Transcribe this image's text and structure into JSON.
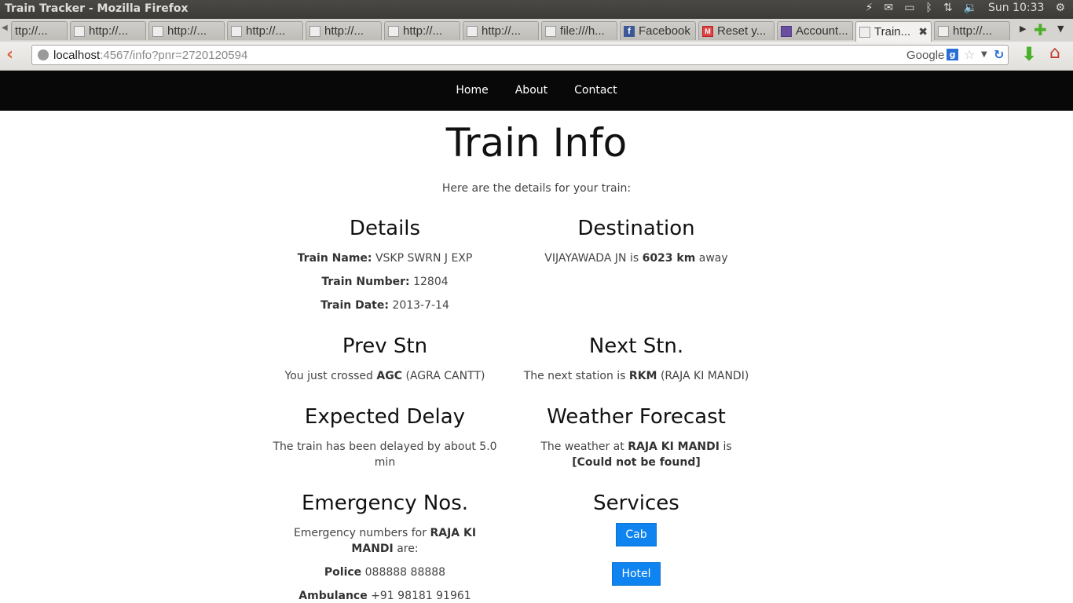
{
  "os": {
    "window_title": "Train Tracker - Mozilla Firefox",
    "clock": "Sun 10:33"
  },
  "tabs": [
    {
      "label": "ttp://..."
    },
    {
      "label": "http://..."
    },
    {
      "label": "http://..."
    },
    {
      "label": "http://..."
    },
    {
      "label": "http://..."
    },
    {
      "label": "http://..."
    },
    {
      "label": "http://..."
    },
    {
      "label": "file:///h..."
    },
    {
      "label": "Facebook"
    },
    {
      "label": "Reset y..."
    },
    {
      "label": "Account..."
    },
    {
      "label": "Train..."
    },
    {
      "label": "http://..."
    }
  ],
  "address_bar": {
    "host": "localhost",
    "path": ":4567/info?pnr=2720120594",
    "search_engine": "Google"
  },
  "site_nav": {
    "home": "Home",
    "about": "About",
    "contact": "Contact"
  },
  "page": {
    "title": "Train Info",
    "intro": "Here are the details for your train:"
  },
  "details": {
    "heading": "Details",
    "train_name_label": "Train Name:",
    "train_name": "VSKP SWRN J EXP",
    "train_number_label": "Train Number:",
    "train_number": "12804",
    "train_date_label": "Train Date:",
    "train_date": "2013-7-14"
  },
  "destination": {
    "heading": "Destination",
    "station": "VIJAYAWADA JN",
    "is": "is",
    "distance": "6023 km",
    "away": "away"
  },
  "prev_stn": {
    "heading": "Prev Stn",
    "prefix": "You just crossed",
    "code": "AGC",
    "name": "(AGRA CANTT)"
  },
  "next_stn": {
    "heading": "Next Stn.",
    "prefix": "The next station is",
    "code": "RKM",
    "name": "(RAJA KI MANDI)"
  },
  "delay": {
    "heading": "Expected Delay",
    "text": "The train has been delayed by about 5.0 min"
  },
  "weather": {
    "heading": "Weather Forecast",
    "prefix": "The weather at",
    "station": "RAJA KI MANDI",
    "is": "is",
    "result": "[Could not be found]"
  },
  "emergency": {
    "heading": "Emergency Nos.",
    "prefix": "Emergency numbers for",
    "station": "RAJA KI MANDI",
    "suffix": "are:",
    "police_label": "Police",
    "police": "088888 88888",
    "ambulance_label": "Ambulance",
    "ambulance": "+91 98181 91961"
  },
  "services": {
    "heading": "Services",
    "cab": "Cab",
    "hotel": "Hotel"
  }
}
